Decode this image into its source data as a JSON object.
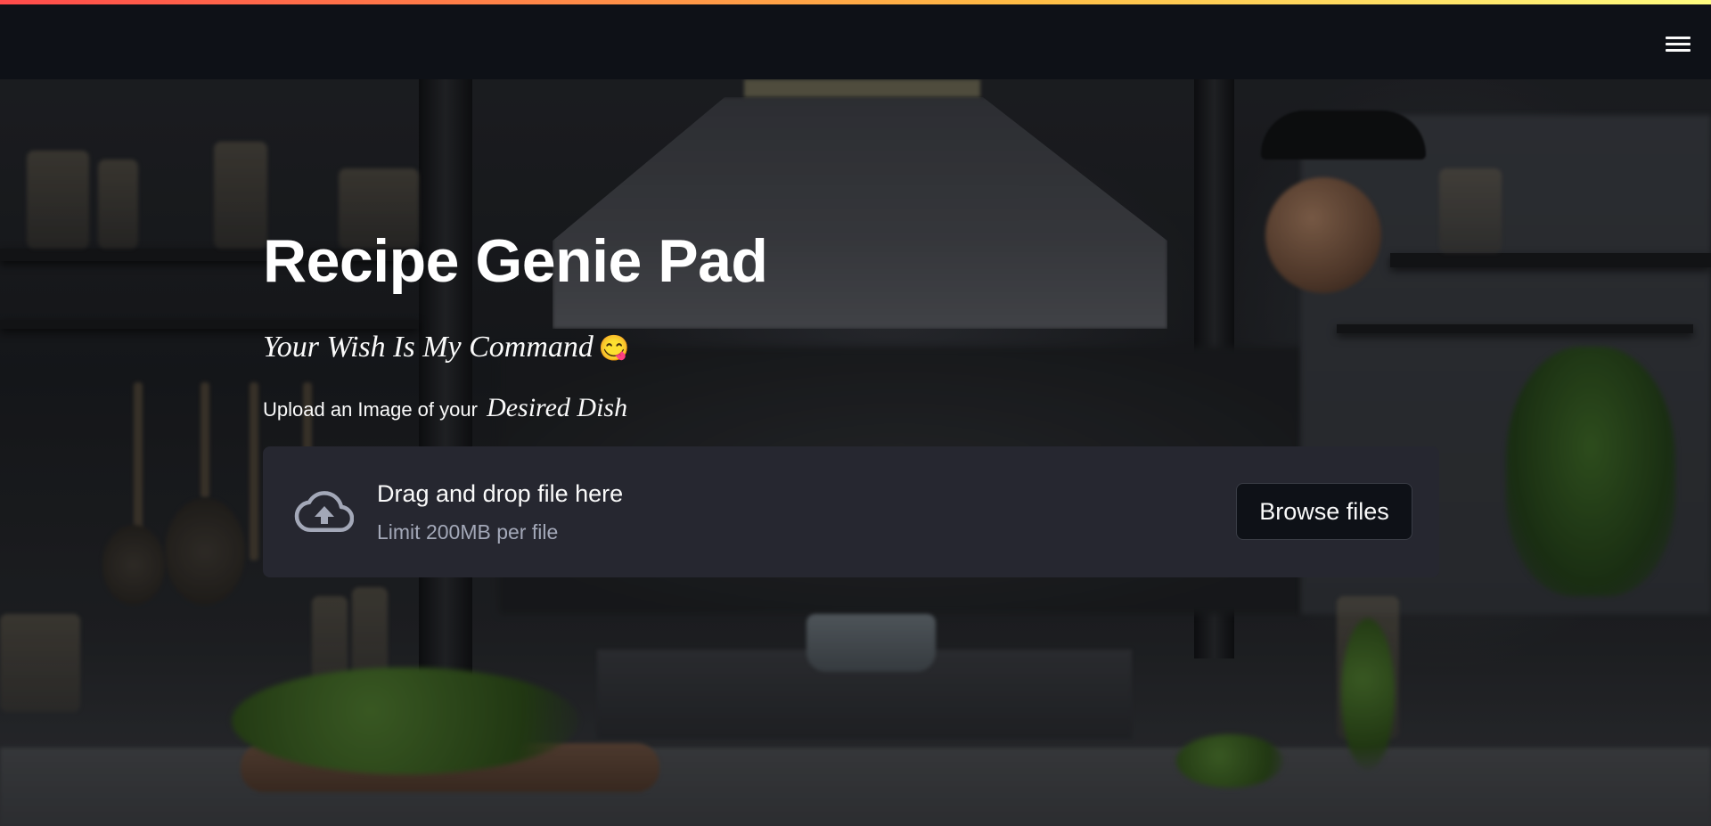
{
  "header": {
    "menu_icon": "hamburger-menu-icon"
  },
  "background": {
    "description_icon": "kitchen-background-image"
  },
  "main": {
    "title": "Recipe Genie Pad",
    "subtitle": "Your Wish Is My Command",
    "subtitle_emoji": "😋",
    "upload_label_prefix": "Upload an Image of your",
    "upload_label_emphasis": "Desired Dish"
  },
  "uploader": {
    "icon": "cloud-upload-icon",
    "instructions": "Drag and drop file here",
    "limit": "Limit 200MB per file",
    "browse_label": "Browse files"
  },
  "colors": {
    "accent_gradient_start": "#ff4b4b",
    "accent_gradient_end": "#fffd80",
    "header_bg": "#0e1117",
    "dropzone_bg": "#262730",
    "text_primary": "#fafafa",
    "text_secondary": "#a3a8b8"
  }
}
